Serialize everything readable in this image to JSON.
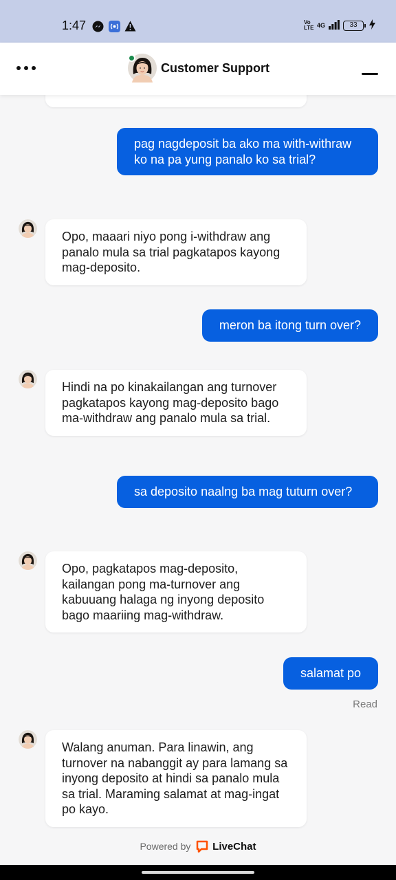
{
  "status_bar": {
    "time": "1:47",
    "network_label": "4G",
    "volte_label": "Vo LTE",
    "battery_level": "33"
  },
  "header": {
    "title": "Customer Support",
    "online": true,
    "status_color": "#1b8a4c"
  },
  "messages": [
    {
      "sender": "user",
      "text": "pag nagdeposit ba ako ma with-withraw ko na pa yung panalo ko sa trial?"
    },
    {
      "sender": "agent",
      "text": "Opo, maaari niyo pong i-withdraw ang panalo mula sa trial pagkatapos kayong mag-deposito."
    },
    {
      "sender": "user",
      "text": "meron ba itong turn over?"
    },
    {
      "sender": "agent",
      "text": "Hindi na po kinakailangan ang turnover pagkatapos kayong mag-deposito bago ma-withdraw ang panalo mula sa trial."
    },
    {
      "sender": "user",
      "text": "sa deposito naalng ba mag tuturn over?"
    },
    {
      "sender": "agent",
      "text": "Opo, pagkatapos mag-deposito, kailangan pong ma-turnover ang kabuuang halaga ng inyong deposito bago maariing mag-withdraw."
    },
    {
      "sender": "user",
      "text": "salamat po"
    },
    {
      "sender": "agent",
      "text": "Walang anuman. Para linawin, ang turnover na nabanggit ay para lamang sa inyong deposito at hindi sa panalo mula sa trial. Maraming salamat at mag-ingat po kayo."
    }
  ],
  "read_receipt": "Read",
  "footer": {
    "powered_by": "Powered by",
    "brand": "LiveChat"
  },
  "colors": {
    "user_bubble": "#0760e0",
    "agent_bubble": "#ffffff",
    "background": "#f6f6f7",
    "livechat_orange": "#ff5100"
  }
}
